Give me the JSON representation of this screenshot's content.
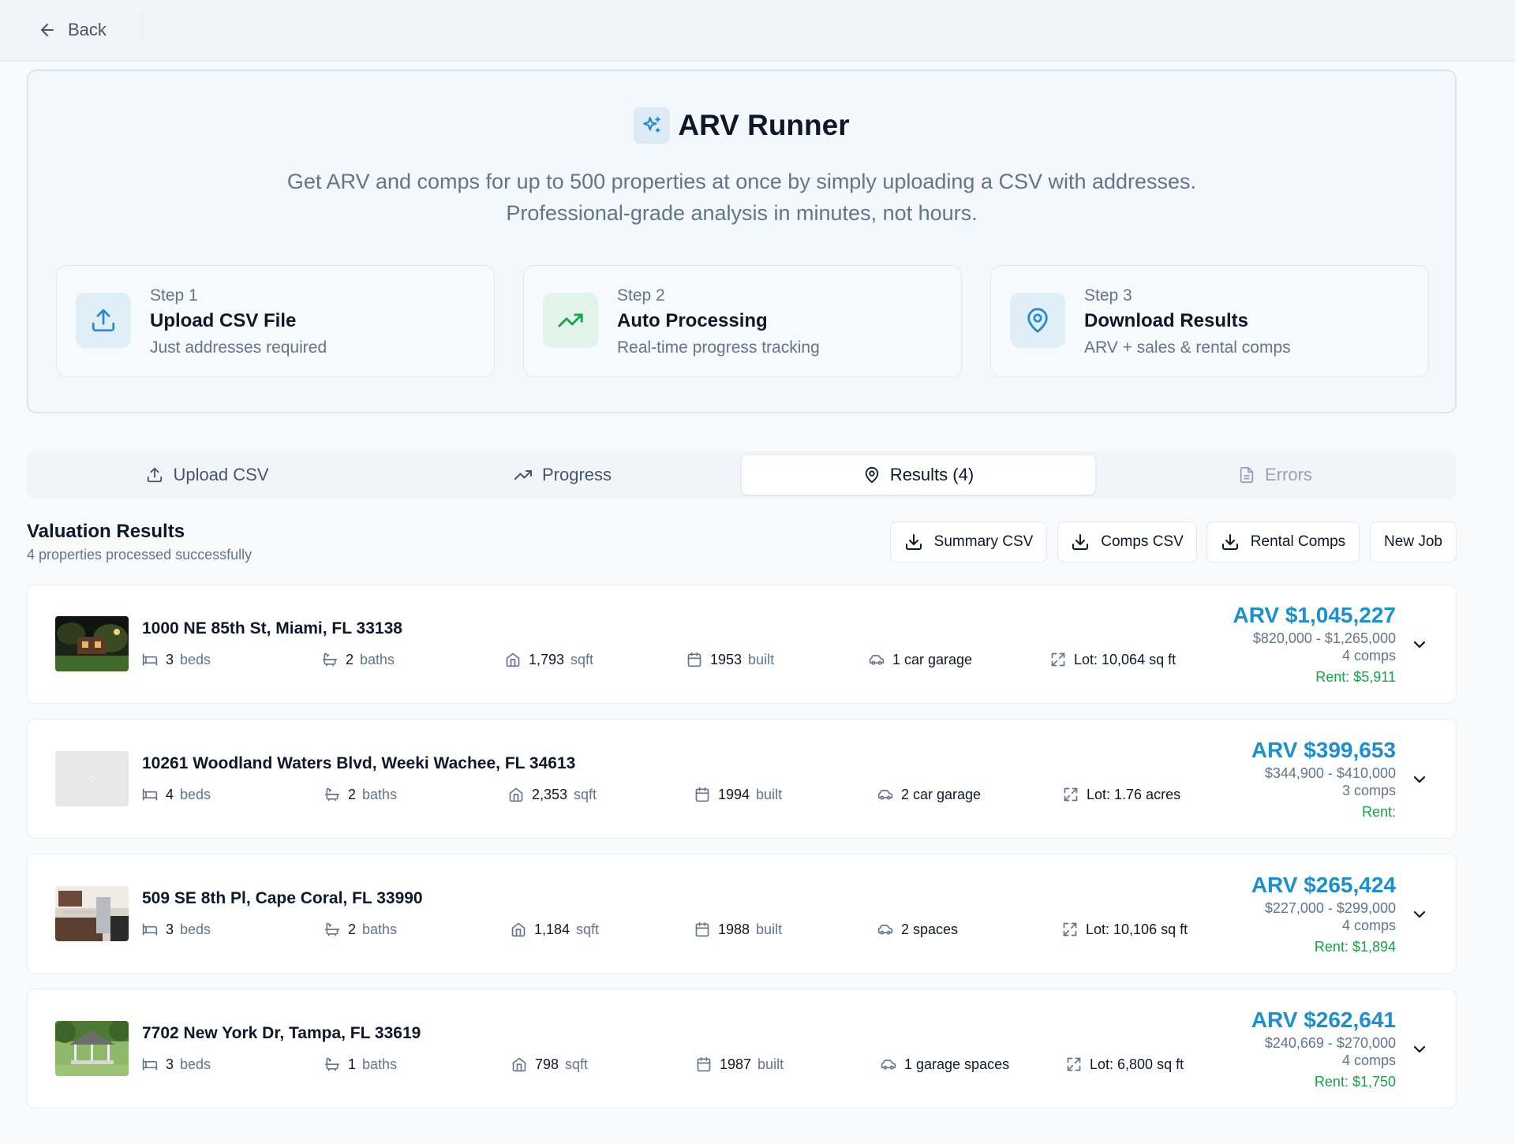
{
  "topbar": {
    "back_label": "Back"
  },
  "hero": {
    "title": "ARV Runner",
    "description": "Get ARV and comps for up to 500 properties at once by simply uploading a CSV with addresses. Professional-grade analysis in minutes, not hours.",
    "steps": [
      {
        "num": "Step 1",
        "title": "Upload CSV File",
        "sub": "Just addresses required",
        "icon": "upload-icon",
        "color": "#2a8ccc",
        "bg": "#e0eef8"
      },
      {
        "num": "Step 2",
        "title": "Auto Processing",
        "sub": "Real-time progress tracking",
        "icon": "trending-up-icon",
        "color": "#16a34a",
        "bg": "#e1f3ea"
      },
      {
        "num": "Step 3",
        "title": "Download Results",
        "sub": "ARV + sales & rental comps",
        "icon": "map-pin-icon",
        "color": "#2a8ccc",
        "bg": "#e0eef8"
      }
    ]
  },
  "tabs": [
    {
      "label": "Upload CSV",
      "icon": "upload-icon",
      "state": "normal"
    },
    {
      "label": "Progress",
      "icon": "trending-up-icon",
      "state": "normal"
    },
    {
      "label": "Results (4)",
      "icon": "map-pin-icon",
      "state": "active"
    },
    {
      "label": "Errors",
      "icon": "file-icon",
      "state": "disabled"
    }
  ],
  "results": {
    "title": "Valuation Results",
    "subtitle": "4 properties processed successfully",
    "buttons": {
      "summary_csv": "Summary CSV",
      "comps_csv": "Comps CSV",
      "rental_comps": "Rental Comps",
      "new_job": "New Job"
    }
  },
  "properties": [
    {
      "address": "1000 NE 85th St, Miami, FL 33138",
      "beds": "3",
      "beds_label": "beds",
      "baths": "2",
      "baths_label": "baths",
      "sqft": "1,793",
      "sqft_label": "sqft",
      "built": "1953",
      "built_label": "built",
      "garage": "1 car garage",
      "lot": "Lot: 10,064 sq ft",
      "arv": "ARV $1,045,227",
      "range": "$820,000 - $1,265,000",
      "comps": "4 comps",
      "rent": "Rent: $5,911",
      "thumb": "night-house"
    },
    {
      "address": "10261 Woodland Waters Blvd, Weeki Wachee, FL 34613",
      "beds": "4",
      "beds_label": "beds",
      "baths": "2",
      "baths_label": "baths",
      "sqft": "2,353",
      "sqft_label": "sqft",
      "built": "1994",
      "built_label": "built",
      "garage": "2 car garage",
      "lot": "Lot: 1.76 acres",
      "arv": "ARV $399,653",
      "range": "$344,900 - $410,000",
      "comps": "3 comps",
      "rent": "Rent:",
      "thumb": "placeholder"
    },
    {
      "address": "509 SE 8th Pl, Cape Coral, FL 33990",
      "beds": "3",
      "beds_label": "beds",
      "baths": "2",
      "baths_label": "baths",
      "sqft": "1,184",
      "sqft_label": "sqft",
      "built": "1988",
      "built_label": "built",
      "garage": "2 spaces",
      "lot": "Lot: 10,106 sq ft",
      "arv": "ARV $265,424",
      "range": "$227,000 - $299,000",
      "comps": "4 comps",
      "rent": "Rent: $1,894",
      "thumb": "kitchen"
    },
    {
      "address": "7702 New York Dr, Tampa, FL 33619",
      "beds": "3",
      "beds_label": "beds",
      "baths": "1",
      "baths_label": "baths",
      "sqft": "798",
      "sqft_label": "sqft",
      "built": "1987",
      "built_label": "built",
      "garage": "1 garage spaces",
      "lot": "Lot: 6,800 sq ft",
      "arv": "ARV $262,641",
      "range": "$240,669 - $270,000",
      "comps": "4 comps",
      "rent": "Rent: $1,750",
      "thumb": "gazebo"
    }
  ],
  "colors": {
    "accent": "#1b8fcf",
    "rent_green": "#16a34a",
    "muted": "#64748b"
  }
}
